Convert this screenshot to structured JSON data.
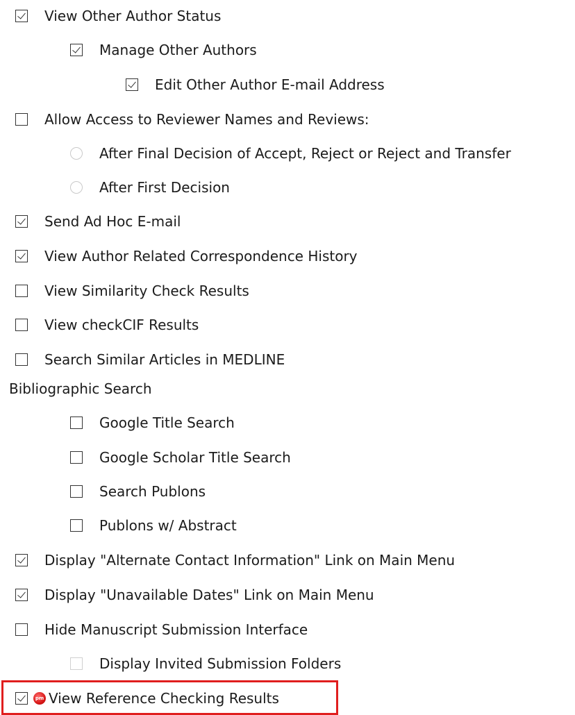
{
  "permissions": {
    "view_other_author_status": {
      "label": "View Other Author Status",
      "checked": true
    },
    "manage_other_authors": {
      "label": "Manage Other Authors",
      "checked": true
    },
    "edit_other_author_email": {
      "label": "Edit Other Author E-mail Address",
      "checked": true
    },
    "allow_reviewer_access": {
      "label": "Allow Access to Reviewer Names and Reviews:",
      "checked": false
    },
    "after_final_decision": {
      "label": "After Final Decision of Accept, Reject or Reject and Transfer",
      "selected": false
    },
    "after_first_decision": {
      "label": "After First Decision",
      "selected": false
    },
    "send_ad_hoc_email": {
      "label": "Send Ad Hoc E-mail",
      "checked": true
    },
    "view_author_correspondence": {
      "label": "View Author Related Correspondence History",
      "checked": true
    },
    "view_similarity_check": {
      "label": "View Similarity Check Results",
      "checked": false
    },
    "view_checkcif": {
      "label": "View checkCIF Results",
      "checked": false
    },
    "search_medline": {
      "label": "Search Similar Articles in MEDLINE",
      "checked": false
    }
  },
  "bibliographic_search": {
    "heading": "Bibliographic Search",
    "google_title_search": {
      "label": "Google Title Search",
      "checked": false
    },
    "google_scholar_title_search": {
      "label": "Google Scholar Title Search",
      "checked": false
    },
    "search_publons": {
      "label": "Search Publons",
      "checked": false
    },
    "publons_abstract": {
      "label": "Publons w/ Abstract",
      "checked": false
    }
  },
  "menu_options": {
    "display_alternate_contact": {
      "label": "Display \"Alternate Contact Information\" Link on Main Menu",
      "checked": true
    },
    "display_unavailable_dates": {
      "label": "Display \"Unavailable Dates\" Link on Main Menu",
      "checked": true
    },
    "hide_submission_interface": {
      "label": "Hide Manuscript Submission Interface",
      "checked": false
    },
    "display_invited_folders": {
      "label": "Display Invited Submission Folders",
      "checked": false,
      "disabled": true
    },
    "view_reference_checking": {
      "label": "View Reference Checking Results",
      "checked": true,
      "icon": "pm-badge-icon",
      "highlight_color": "#e01e1e"
    }
  }
}
